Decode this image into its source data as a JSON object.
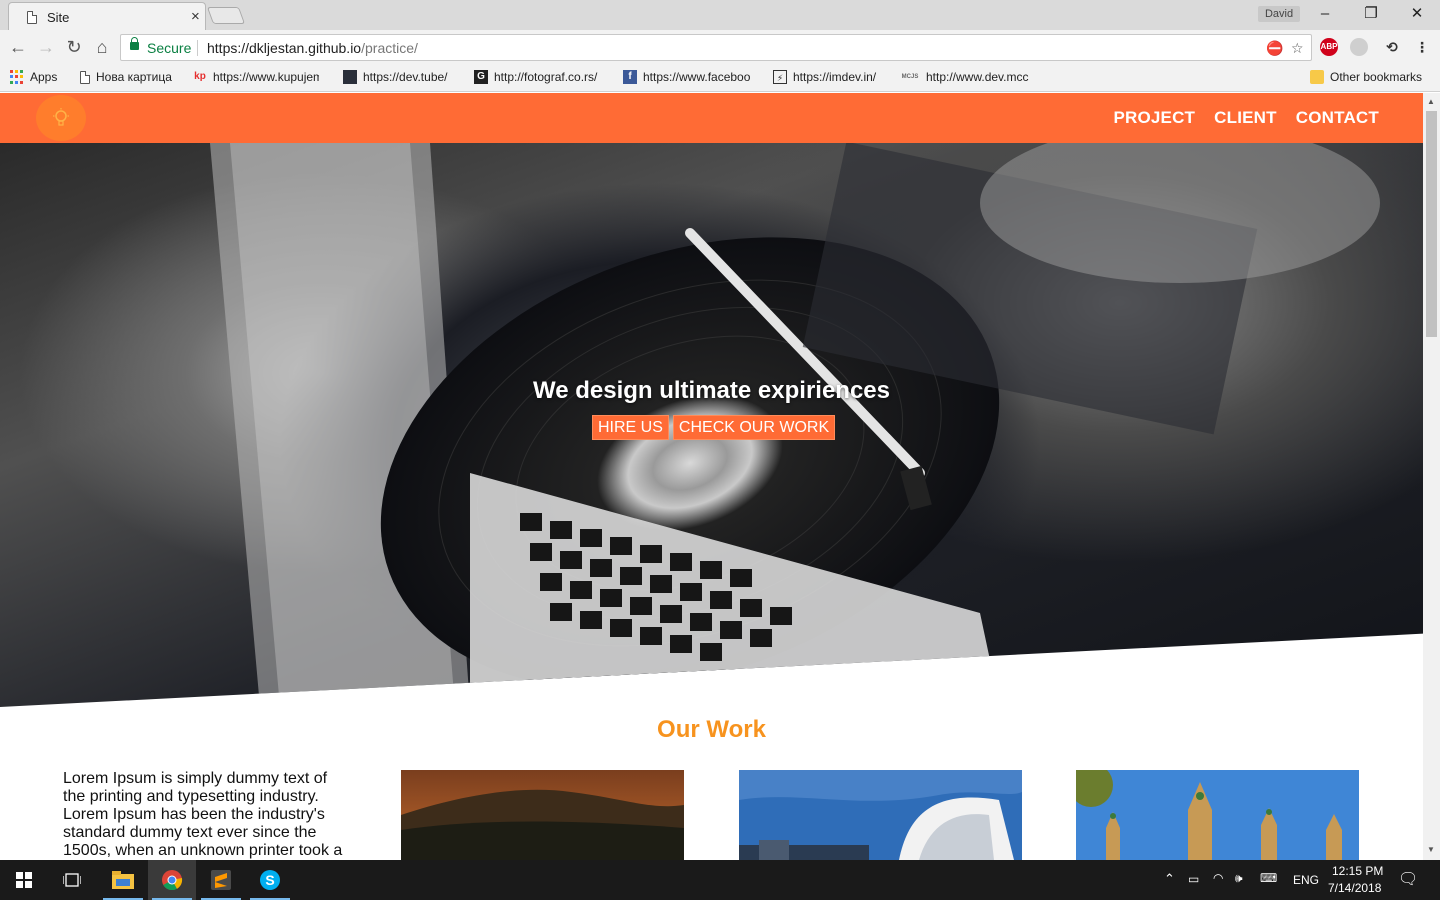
{
  "browser": {
    "tab_title": "Site",
    "tab_close": "×",
    "user_name": "David",
    "minimize": "–",
    "maximize": "❐",
    "close": "✕",
    "secure_label": "Secure",
    "url_host": "https://dkljestan.github.io",
    "url_path": "/practice/"
  },
  "bookmarks": [
    {
      "label": "Apps",
      "icon": "apps-icon"
    },
    {
      "label": "Нова картица",
      "icon": "page-icon"
    },
    {
      "label": "https://www.kupujem",
      "icon": "kp-icon",
      "badge": "kp"
    },
    {
      "label": "https://dev.tube/",
      "icon": "devtube-icon"
    },
    {
      "label": "http://fotograf.co.rs/",
      "icon": "g-icon",
      "badge": "G"
    },
    {
      "label": "https://www.faceboo",
      "icon": "facebook-icon",
      "badge": "f"
    },
    {
      "label": "https://imdev.in/",
      "icon": "bolt-icon",
      "badge": "⚡"
    },
    {
      "label": "http://www.dev.mcc",
      "icon": "mcc-icon",
      "badge": "MCJS"
    },
    {
      "label": "Other bookmarks",
      "icon": "folder-icon"
    }
  ],
  "site": {
    "nav": [
      "PROJECT",
      "CLIENT",
      "CONTACT"
    ],
    "hero_title": "We design ultimate expiriences",
    "hire_btn": "HIRE US",
    "work_btn": "CHECK OUR WORK",
    "section_title": "Our Work",
    "lorem": "Lorem Ipsum is simply dummy text of the printing and typesetting industry. Lorem Ipsum has been the industry's standard dummy text ever since the 1500s, when an unknown printer took a"
  },
  "taskbar": {
    "lang": "ENG",
    "time": "12:15 PM",
    "date": "7/14/2018"
  },
  "colors": {
    "accent": "#ff6b35",
    "section_title": "#f7931e"
  }
}
